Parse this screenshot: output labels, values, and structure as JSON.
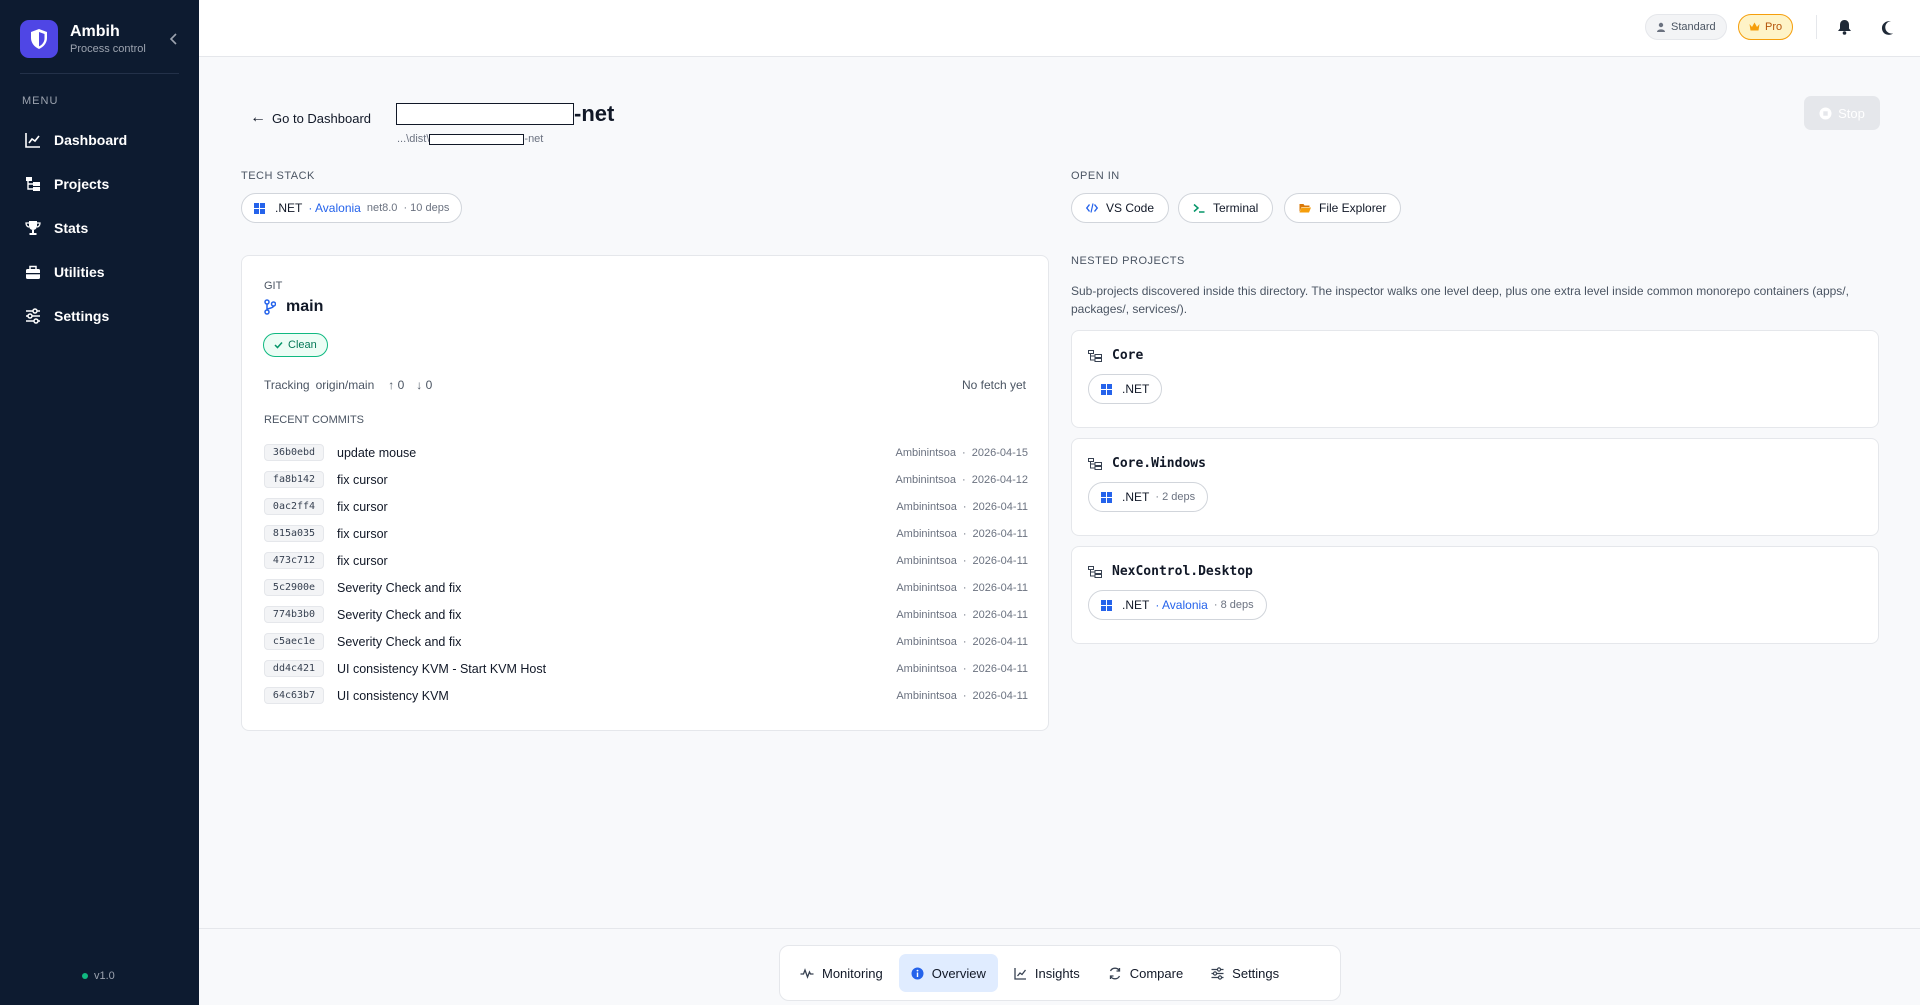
{
  "app": {
    "name": "Ambih",
    "subtitle": "Process control",
    "version": "v1.0"
  },
  "sidebar": {
    "menu_label": "MENU",
    "items": [
      {
        "label": "Dashboard",
        "icon": "chart-line-icon"
      },
      {
        "label": "Projects",
        "icon": "folder-tree-icon"
      },
      {
        "label": "Stats",
        "icon": "trophy-icon"
      },
      {
        "label": "Utilities",
        "icon": "toolbox-icon"
      },
      {
        "label": "Settings",
        "icon": "sliders-icon"
      }
    ]
  },
  "topbar": {
    "standard_label": "Standard",
    "pro_label": "Pro"
  },
  "header": {
    "back_label": "Go to Dashboard",
    "title_suffix": "-net",
    "path_prefix": "...\\dist\\",
    "path_suffix": "-net",
    "stop_label": "Stop"
  },
  "tech_stack": {
    "label": "TECH STACK",
    "runtime": ".NET",
    "framework": "Avalonia",
    "target": "net8.0",
    "deps": "10 deps"
  },
  "open_in": {
    "label": "OPEN IN",
    "vscode": "VS Code",
    "terminal": "Terminal",
    "explorer": "File Explorer"
  },
  "git": {
    "label": "GIT",
    "branch": "main",
    "status": "Clean",
    "tracking_label": "Tracking",
    "remote": "origin/main",
    "ahead": "↑ 0",
    "behind": "↓ 0",
    "fetch_status": "No fetch yet",
    "recent_label": "RECENT COMMITS",
    "commits": [
      {
        "hash": "36b0ebd",
        "message": "update mouse",
        "author": "Ambinintsoa",
        "date": "2026-04-15"
      },
      {
        "hash": "fa8b142",
        "message": "fix cursor",
        "author": "Ambinintsoa",
        "date": "2026-04-12"
      },
      {
        "hash": "0ac2ff4",
        "message": "fix cursor",
        "author": "Ambinintsoa",
        "date": "2026-04-11"
      },
      {
        "hash": "815a035",
        "message": "fix cursor",
        "author": "Ambinintsoa",
        "date": "2026-04-11"
      },
      {
        "hash": "473c712",
        "message": "fix cursor",
        "author": "Ambinintsoa",
        "date": "2026-04-11"
      },
      {
        "hash": "5c2900e",
        "message": "Severity Check and fix",
        "author": "Ambinintsoa",
        "date": "2026-04-11"
      },
      {
        "hash": "774b3b0",
        "message": "Severity Check and fix",
        "author": "Ambinintsoa",
        "date": "2026-04-11"
      },
      {
        "hash": "c5aec1e",
        "message": "Severity Check and fix",
        "author": "Ambinintsoa",
        "date": "2026-04-11"
      },
      {
        "hash": "dd4c421",
        "message": "UI consistency KVM - Start KVM Host",
        "author": "Ambinintsoa",
        "date": "2026-04-11"
      },
      {
        "hash": "64c63b7",
        "message": "UI consistency KVM",
        "author": "Ambinintsoa",
        "date": "2026-04-11"
      }
    ]
  },
  "nested": {
    "label": "NESTED PROJECTS",
    "description": "Sub-projects discovered inside this directory. The inspector walks one level deep, plus one extra level inside common monorepo containers (apps/, packages/, services/).",
    "projects": [
      {
        "name": "Core",
        "runtime": ".NET",
        "framework": "",
        "deps": ""
      },
      {
        "name": "Core.Windows",
        "runtime": ".NET",
        "framework": "",
        "deps": "2 deps"
      },
      {
        "name": "NexControl.Desktop",
        "runtime": ".NET",
        "framework": "Avalonia",
        "deps": "8 deps"
      }
    ]
  },
  "tabs": [
    {
      "label": "Monitoring",
      "icon": "activity-icon",
      "active": false
    },
    {
      "label": "Overview",
      "icon": "info-icon",
      "active": true
    },
    {
      "label": "Insights",
      "icon": "chart-line-icon",
      "active": false
    },
    {
      "label": "Compare",
      "icon": "compare-icon",
      "active": false
    },
    {
      "label": "Settings",
      "icon": "sliders-icon",
      "active": false
    }
  ],
  "colors": {
    "sidebar": "#0d1b30",
    "accent": "#4f46e5",
    "link": "#2563eb",
    "success": "#10b981",
    "pro": "#f59e0b"
  }
}
